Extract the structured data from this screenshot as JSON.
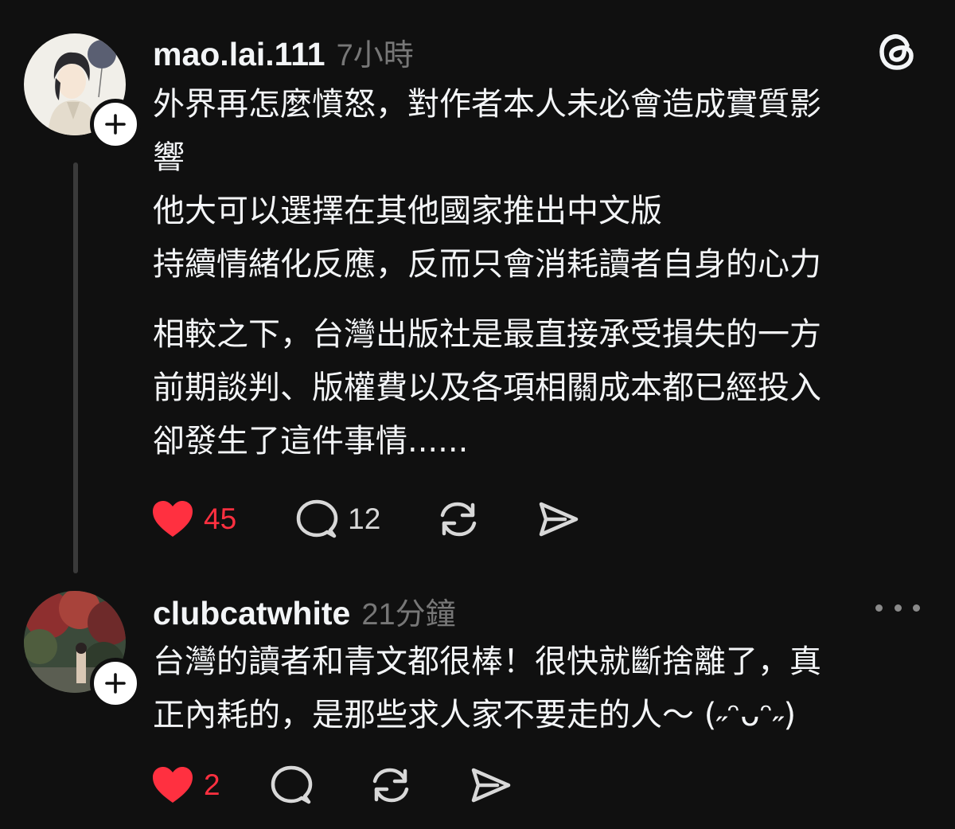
{
  "posts": [
    {
      "username": "mao.lai.111",
      "timestamp": "7小時",
      "paragraphs": [
        [
          "外界再怎麼憤怒，對作者本人未必會造成實質影",
          "響",
          "他大可以選擇在其他國家推出中文版",
          "持續情緒化反應，反而只會消耗讀者自身的心力"
        ],
        [
          "相較之下，台灣出版社是最直接承受損失的一方",
          "前期談判、版權費以及各項相關成本都已經投入",
          "卻發生了這件事情......"
        ]
      ],
      "likes": "45",
      "replies": "12",
      "liked": true
    },
    {
      "username": "clubcatwhite",
      "timestamp": "21分鐘",
      "paragraphs": [
        [
          "台灣的讀者和青文都很棒！很快就斷捨離了，真",
          "正內耗的，是那些求人家不要走的人～ (˶ᵔᴗᵔ˶)"
        ]
      ],
      "likes": "2",
      "replies": "",
      "liked": true
    }
  ],
  "icons": {
    "app_logo": "threads-logo-icon",
    "like": "heart-icon",
    "reply": "comment-bubble-icon",
    "repost": "repost-icon",
    "share": "send-icon",
    "follow": "plus-icon",
    "more": "more-dots-icon"
  },
  "colors": {
    "background": "#101010",
    "text": "#f3f5f7",
    "muted": "#777777",
    "like_red": "#ff3040",
    "thread_line": "#3a3a3a"
  }
}
